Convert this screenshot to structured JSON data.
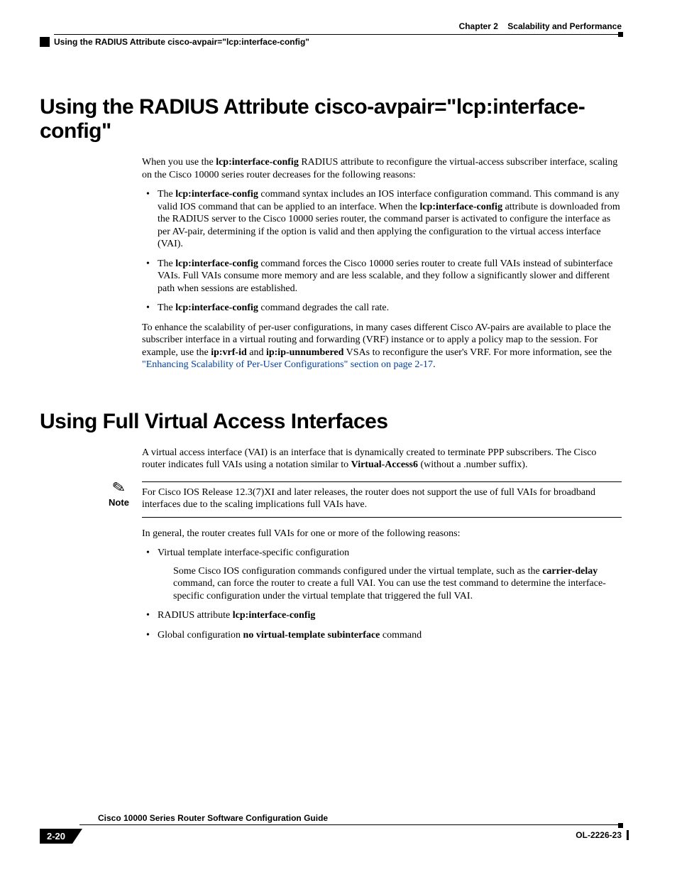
{
  "header": {
    "chapter_label": "Chapter 2",
    "chapter_title": "Scalability and Performance",
    "running_title": "Using the RADIUS Attribute cisco-avpair=\"lcp:interface-config\""
  },
  "section1": {
    "title": "Using the RADIUS Attribute cisco-avpair=\"lcp:interface-config\"",
    "intro_pre": "When you use the ",
    "intro_bold1": "lcp:interface-config",
    "intro_post": " RADIUS attribute to reconfigure the virtual-access subscriber interface, scaling on the Cisco 10000 series router decreases for the following reasons:",
    "b1_pre": "The ",
    "b1_bold1": "lcp:interface-config",
    "b1_mid1": " command syntax includes an IOS interface configuration command. This command is any valid IOS command that can be applied to an interface. When the ",
    "b1_bold2": "lcp:interface-config",
    "b1_mid2": " attribute is downloaded from the RADIUS server to the Cisco 10000 series router, the command parser is activated to configure the interface as per AV-pair, determining if the option is valid and then applying the configuration to the virtual access interface (VAI).",
    "b2_pre": "The ",
    "b2_bold1": "lcp:interface-config",
    "b2_post": " command forces the Cisco 10000 series router to create full VAIs instead of subinterface VAIs. Full VAIs consume more memory and are less scalable, and they follow a significantly slower and different path when sessions are established.",
    "b3_pre": "The ",
    "b3_bold1": "lcp:interface-config",
    "b3_post": " command degrades the call rate.",
    "tail_pre": "To enhance the scalability of per-user configurations, in many cases different Cisco AV-pairs are available to place the subscriber interface in a virtual routing and forwarding (VRF) instance or to apply a policy map to the session. For example, use the ",
    "tail_bold1": "ip:vrf-id",
    "tail_mid1": " and ",
    "tail_bold2": "ip:ip-unnumbered",
    "tail_mid2": " VSAs to reconfigure the user's VRF. For more information, see the ",
    "tail_link": "\"Enhancing Scalability of Per-User Configurations\" section on page 2-17",
    "tail_post": "."
  },
  "section2": {
    "title": "Using Full Virtual Access Interfaces",
    "intro_pre": "A virtual access interface (VAI) is an interface that is dynamically created to terminate PPP subscribers. The Cisco router indicates full VAIs using a notation similar to ",
    "intro_bold1": "Virtual-Access6",
    "intro_post": " (without a .number suffix).",
    "note_label": "Note",
    "note_text": "For Cisco IOS Release 12.3(7)XI and later releases, the router does not support the use of full VAIs for broadband interfaces due to the scaling implications full VAIs have.",
    "lead2": "In general, the router creates full VAIs for one or more of the following reasons:",
    "b1": "Virtual template interface-specific configuration",
    "b1_sub_pre": "Some Cisco IOS configuration commands configured under the virtual template, such as the ",
    "b1_sub_bold": "carrier-delay",
    "b1_sub_post": " command, can force the router to create a full VAI. You can use the test command to determine the interface-specific configuration under the virtual template that triggered the full VAI.",
    "b2_pre": "RADIUS attribute ",
    "b2_bold": "lcp:interface-config",
    "b3_pre": "Global configuration ",
    "b3_bold": "no virtual-template subinterface",
    "b3_post": " command"
  },
  "footer": {
    "guide_title": "Cisco 10000 Series Router Software Configuration Guide",
    "page_number": "2-20",
    "doc_id": "OL-2226-23"
  }
}
